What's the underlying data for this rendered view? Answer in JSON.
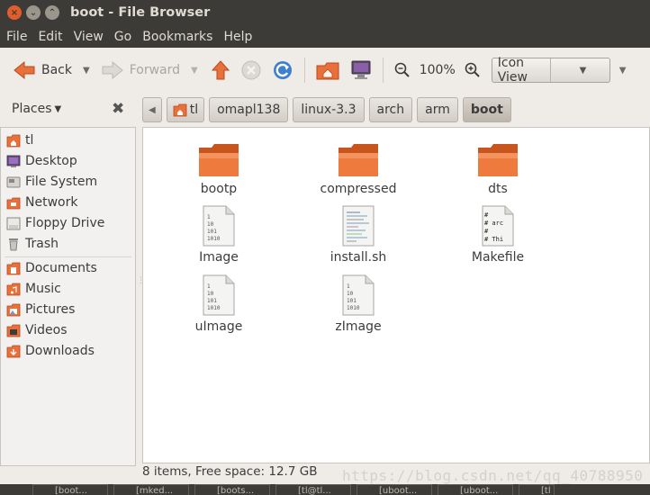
{
  "window": {
    "title": "boot - File Browser",
    "buttons": {
      "close": "×",
      "min": "⌄",
      "max": "⌃"
    }
  },
  "menu": [
    "File",
    "Edit",
    "View",
    "Go",
    "Bookmarks",
    "Help"
  ],
  "toolbar": {
    "back_label": "Back",
    "forward_label": "Forward",
    "zoom_level": "100%",
    "view_mode": "Icon View"
  },
  "sidebar": {
    "header": "Places",
    "items": [
      {
        "label": "tl",
        "icon": "home-folder-icon"
      },
      {
        "label": "Desktop",
        "icon": "desktop-icon"
      },
      {
        "label": "File System",
        "icon": "drive-icon"
      },
      {
        "label": "Network",
        "icon": "network-icon"
      },
      {
        "label": "Floppy Drive",
        "icon": "floppy-icon"
      },
      {
        "label": "Trash",
        "icon": "trash-icon"
      },
      {
        "label": "Documents",
        "icon": "folder-icon"
      },
      {
        "label": "Music",
        "icon": "folder-icon"
      },
      {
        "label": "Pictures",
        "icon": "folder-icon"
      },
      {
        "label": "Videos",
        "icon": "folder-icon"
      },
      {
        "label": "Downloads",
        "icon": "folder-icon"
      }
    ]
  },
  "path": [
    "tl",
    "omapl138",
    "linux-3.3",
    "arch",
    "arm",
    "boot"
  ],
  "files": [
    {
      "name": "bootp",
      "type": "folder"
    },
    {
      "name": "compressed",
      "type": "folder"
    },
    {
      "name": "dts",
      "type": "folder"
    },
    {
      "name": "Image",
      "type": "binary"
    },
    {
      "name": "install.sh",
      "type": "script"
    },
    {
      "name": "Makefile",
      "type": "makefile"
    },
    {
      "name": "uImage",
      "type": "binary"
    },
    {
      "name": "zImage",
      "type": "binary"
    }
  ],
  "status": "8 items, Free space: 12.7 GB",
  "watermark": "https://blog.csdn.net/qq_40788950",
  "taskbar": [
    "[boot...",
    "[mked...",
    "[boots...",
    "[tl@tl...",
    "[uboot...",
    "[uboot...",
    "[tl - Fil..."
  ],
  "colors": {
    "accent": "#e35d2b",
    "folder": "#e8703a",
    "titlebar": "#3c3b37",
    "window_bg": "#efebe7"
  }
}
